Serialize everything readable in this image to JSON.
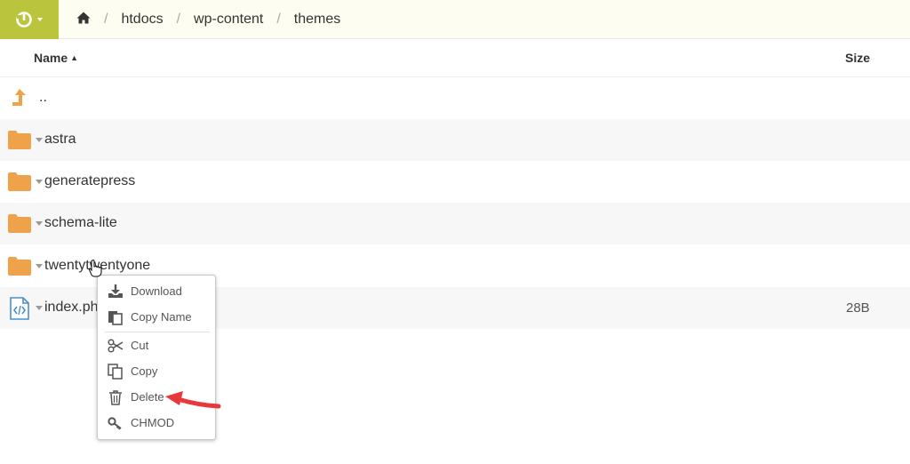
{
  "breadcrumb": [
    "htdocs",
    "wp-content",
    "themes"
  ],
  "columns": {
    "name": "Name",
    "size": "Size"
  },
  "rows": [
    {
      "name": "..",
      "type": "parent",
      "size": ""
    },
    {
      "name": "astra",
      "type": "folder",
      "size": ""
    },
    {
      "name": "generatepress",
      "type": "folder",
      "size": ""
    },
    {
      "name": "schema-lite",
      "type": "folder",
      "size": ""
    },
    {
      "name": "twentytwentyone",
      "type": "folder",
      "size": ""
    },
    {
      "name": "index.php",
      "type": "file",
      "size": "28B"
    }
  ],
  "context_menu": [
    {
      "label": "Download",
      "icon": "download-icon"
    },
    {
      "label": "Copy Name",
      "icon": "copy-name-icon"
    },
    {
      "label": "Cut",
      "icon": "scissors-icon"
    },
    {
      "label": "Copy",
      "icon": "copy-icon"
    },
    {
      "label": "Delete",
      "icon": "trash-icon"
    },
    {
      "label": "CHMOD",
      "icon": "key-icon"
    }
  ],
  "colors": {
    "accent": "#bac43c",
    "folder": "#f0a24a",
    "parent_arrow": "#f0a24a",
    "file_icon": "#4a90c8",
    "annotation_arrow": "#e8383a"
  }
}
